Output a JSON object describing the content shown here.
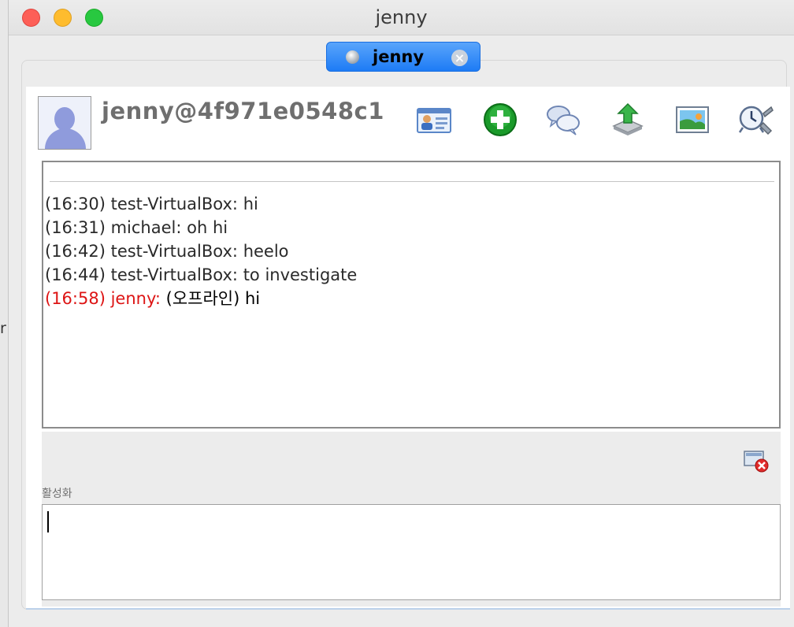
{
  "window": {
    "title": "jenny"
  },
  "tab": {
    "label": "jenny"
  },
  "contact": {
    "id": "jenny@4f971e0548c1"
  },
  "toolbar": [
    {
      "name": "contact-card-icon"
    },
    {
      "name": "add-contact-icon"
    },
    {
      "name": "group-chat-icon"
    },
    {
      "name": "send-file-icon"
    },
    {
      "name": "send-image-icon"
    },
    {
      "name": "alarm-settings-icon"
    }
  ],
  "messages": [
    {
      "meta": "(16:30) test-VirtualBox:",
      "text": "hi",
      "highlight": false
    },
    {
      "meta": "(16:31) michael:",
      "text": "oh hi",
      "highlight": false
    },
    {
      "meta": "(16:42) test-VirtualBox:",
      "text": "heelo",
      "highlight": false
    },
    {
      "meta": "(16:44) test-VirtualBox:",
      "text": "to investigate",
      "highlight": false
    },
    {
      "meta": "(16:58) jenny:",
      "text": "(오프라인) hi",
      "highlight": true
    }
  ],
  "input": {
    "status_label": "활성화",
    "value": ""
  },
  "background": {
    "edge_char": "r"
  },
  "colors": {
    "tab_accent": "#1d7bf5",
    "highlight_meta": "#dd1414"
  }
}
